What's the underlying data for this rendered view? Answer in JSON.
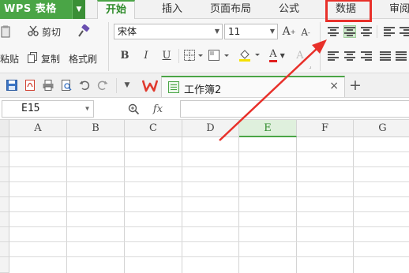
{
  "app": {
    "title": "WPS 表格",
    "accent": "#4aa546"
  },
  "menu": {
    "tabs": [
      {
        "label": "开始"
      },
      {
        "label": "插入"
      },
      {
        "label": "页面布局"
      },
      {
        "label": "公式"
      },
      {
        "label": "数据"
      },
      {
        "label": "审阅"
      }
    ]
  },
  "toolbar": {
    "cut_label": "剪切",
    "paste_label": "粘贴",
    "copy_label": "复制",
    "format_painter_label": "格式刷",
    "font_name": "宋体",
    "font_size": "11",
    "bold": "B",
    "italic": "I",
    "underline": "U",
    "grow_font": "A",
    "shrink_font": "A",
    "font_color_glyph": "A",
    "highlight_glyph": "A"
  },
  "document": {
    "tab_name": "工作簿2",
    "close_glyph": "×",
    "new_tab_glyph": "+"
  },
  "formula_bar": {
    "name_box": "E15",
    "fx_label": "fx",
    "value": ""
  },
  "grid": {
    "columns": [
      "A",
      "B",
      "C",
      "D",
      "E",
      "F",
      "G"
    ],
    "selected_column": "E"
  },
  "annotation": {
    "color": "#e8302a"
  }
}
